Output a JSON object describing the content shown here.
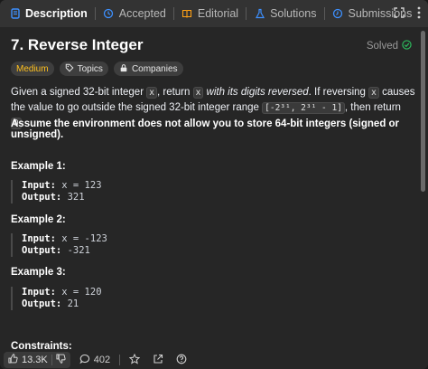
{
  "tabs": [
    {
      "label": "Description",
      "icon": "description-icon",
      "active": true
    },
    {
      "label": "Accepted",
      "icon": "history-icon",
      "active": false
    },
    {
      "label": "Editorial",
      "icon": "book-icon",
      "active": false
    },
    {
      "label": "Solutions",
      "icon": "flask-icon",
      "active": false
    },
    {
      "label": "Submissions",
      "icon": "clock-icon",
      "active": false
    }
  ],
  "problem": {
    "title": "7. Reverse Integer",
    "status": "Solved",
    "difficulty": "Medium",
    "topics_label": "Topics",
    "companies_label": "Companies",
    "desc_1": "Given a signed 32-bit integer ",
    "desc_x1": "x",
    "desc_2": ", return ",
    "desc_x2": "x",
    "desc_em": " with its digits reversed",
    "desc_3": ". If reversing ",
    "desc_x3": "x",
    "desc_4": " causes the value to go outside the signed 32-bit integer range ",
    "desc_range": "[-2³¹, 2³¹ - 1]",
    "desc_5": ", then return ",
    "desc_zero": "0",
    "desc_6": ".",
    "assume": "Assume the environment does not allow you to store 64-bit integers (signed or unsigned).",
    "constraints_label": "Constraints:"
  },
  "examples": [
    {
      "title": "Example 1:",
      "input_label": "Input:",
      "input": "x = 123",
      "output_label": "Output:",
      "output": "321"
    },
    {
      "title": "Example 2:",
      "input_label": "Input:",
      "input": "x = -123",
      "output_label": "Output:",
      "output": "-321"
    },
    {
      "title": "Example 3:",
      "input_label": "Input:",
      "input": "x = 120",
      "output_label": "Output:",
      "output": "21"
    }
  ],
  "bottom": {
    "likes": "13.3K",
    "comments": "402"
  },
  "colors": {
    "accent_difficulty": "#ffc01e",
    "solved_check": "#2cbb5d",
    "tab_active_icon": "#3d90ff"
  }
}
